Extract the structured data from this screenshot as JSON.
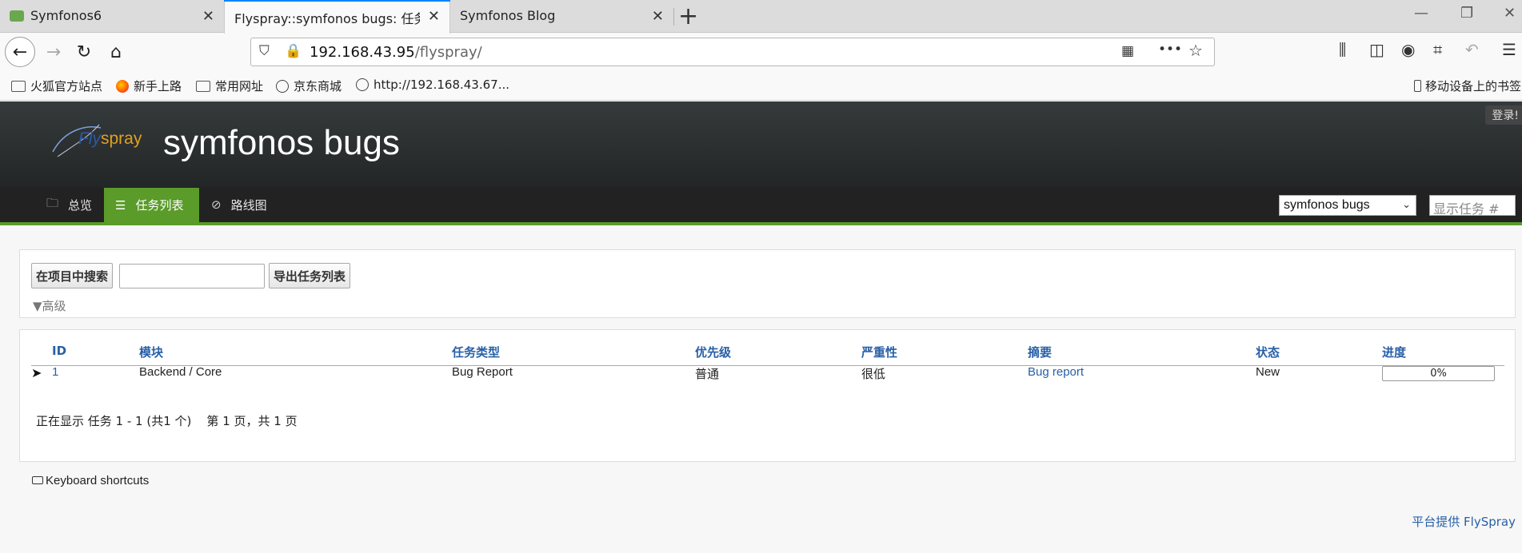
{
  "browser": {
    "tabs": [
      {
        "title": "Symfonos6",
        "active": false
      },
      {
        "title": "Flyspray::symfonos bugs: 任务列表",
        "active": true
      },
      {
        "title": "Symfonos Blog",
        "active": false
      }
    ],
    "url_host": "192.168.43.95",
    "url_path": "/flyspray/",
    "bookmarks": [
      "火狐官方站点",
      "新手上路",
      "常用网址",
      "京东商城",
      "http://192.168.43.67...",
      "移动设备上的书签"
    ]
  },
  "header": {
    "login_label": "登录!",
    "logo_fly": "Fly",
    "logo_spray": "spray",
    "site_title": "symfonos bugs"
  },
  "menu": {
    "items": [
      {
        "label": "总览",
        "icon": "folder-icon"
      },
      {
        "label": "任务列表",
        "icon": "list-icon"
      },
      {
        "label": "路线图",
        "icon": "compass-icon"
      }
    ],
    "project_select": "symfonos bugs",
    "task_number_placeholder": "显示任务 #"
  },
  "search": {
    "search_button": "在项目中搜索",
    "query_value": "",
    "export_button": "导出任务列表",
    "advanced_label": "▼高级"
  },
  "tasks": {
    "columns": [
      "ID",
      "模块",
      "任务类型",
      "优先级",
      "严重性",
      "摘要",
      "状态",
      "进度"
    ],
    "rows": [
      {
        "id": "1",
        "category": "Backend / Core",
        "type": "Bug Report",
        "priority": "普通",
        "severity": "很低",
        "summary": "Bug report",
        "status": "New",
        "progress_percent": 0,
        "progress_label": "0%"
      }
    ],
    "paging": "正在显示 任务 1 - 1 (共1 个)    第 1 页，共 1 页"
  },
  "keyboard_shortcuts": "Keyboard shortcuts",
  "footer": "平台提供 FlySpray",
  "colors": {
    "accent_green": "#5a9b2a",
    "link_blue": "#2860a8",
    "header_dark": "#2b2f30"
  }
}
